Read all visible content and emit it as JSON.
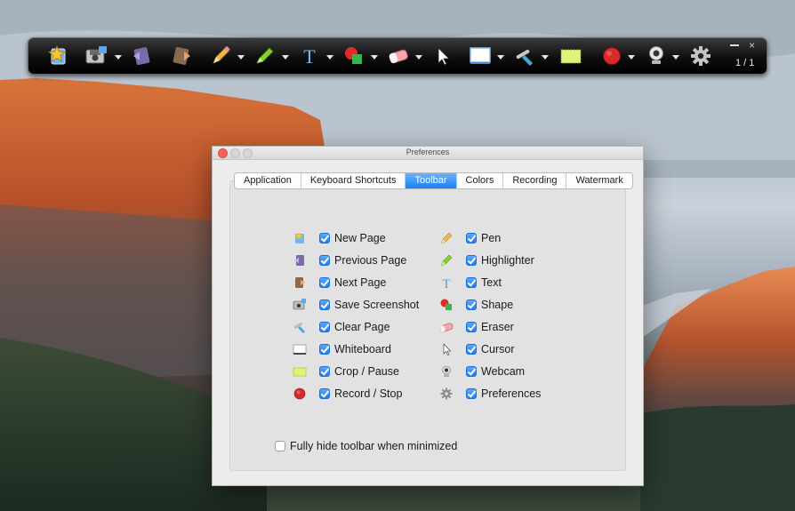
{
  "toolbar": {
    "tools": [
      {
        "icon": "new-page-star-icon"
      },
      {
        "icon": "save-screenshot-icon"
      },
      {
        "icon": "previous-page-icon"
      },
      {
        "icon": "next-page-icon"
      },
      {
        "icon": "pencil-icon"
      },
      {
        "icon": "highlighter-icon"
      },
      {
        "icon": "text-icon"
      },
      {
        "icon": "shape-icon"
      },
      {
        "icon": "eraser-icon"
      },
      {
        "icon": "cursor-icon"
      },
      {
        "icon": "whiteboard-icon"
      },
      {
        "icon": "clear-page-icon"
      },
      {
        "icon": "crop-icon"
      },
      {
        "icon": "record-icon"
      },
      {
        "icon": "webcam-icon"
      },
      {
        "icon": "gear-icon"
      }
    ],
    "page_indicator": "1 / 1",
    "close_glyph": "×"
  },
  "window": {
    "title": "Preferences",
    "tabs": [
      "Application",
      "Keyboard Shortcuts",
      "Toolbar",
      "Colors",
      "Recording",
      "Watermark"
    ],
    "active_tab": "Toolbar"
  },
  "left_column": [
    {
      "label": "New Page",
      "checked": true,
      "icon": "new-page-icon"
    },
    {
      "label": "Previous Page",
      "checked": true,
      "icon": "previous-page-icon"
    },
    {
      "label": "Next Page",
      "checked": true,
      "icon": "next-page-icon"
    },
    {
      "label": "Save Screenshot",
      "checked": true,
      "icon": "save-screenshot-icon"
    },
    {
      "label": "Clear Page",
      "checked": true,
      "icon": "clear-page-icon"
    },
    {
      "label": "Whiteboard",
      "checked": true,
      "icon": "whiteboard-icon"
    },
    {
      "label": "Crop / Pause",
      "checked": true,
      "icon": "crop-icon"
    },
    {
      "label": "Record / Stop",
      "checked": true,
      "icon": "record-icon"
    }
  ],
  "right_column": [
    {
      "label": "Pen",
      "checked": true,
      "icon": "pen-icon"
    },
    {
      "label": "Highlighter",
      "checked": true,
      "icon": "highlighter-icon"
    },
    {
      "label": "Text",
      "checked": true,
      "icon": "text-icon"
    },
    {
      "label": "Shape",
      "checked": true,
      "icon": "shape-icon"
    },
    {
      "label": "Eraser",
      "checked": true,
      "icon": "eraser-icon"
    },
    {
      "label": "Cursor",
      "checked": true,
      "icon": "cursor-icon"
    },
    {
      "label": "Webcam",
      "checked": true,
      "icon": "webcam-icon"
    },
    {
      "label": "Preferences",
      "checked": true,
      "icon": "gear-icon"
    }
  ],
  "hide_option": {
    "label": "Fully hide toolbar when minimized",
    "checked": false
  },
  "colors": {
    "accent": "#1f7ef0",
    "toolbar_bg": "#111111",
    "record_red": "#d62b2b",
    "highlighter_green": "#86d22a",
    "crop_yellow": "#dff27a"
  }
}
